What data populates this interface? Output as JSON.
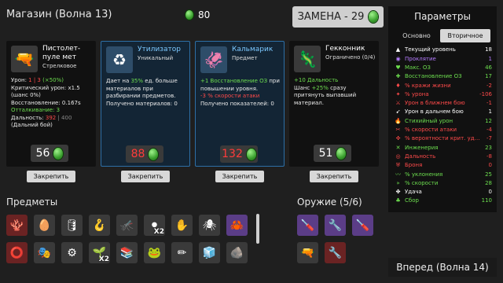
{
  "header": {
    "title": "Магазин (Волна 13)",
    "materials": "80",
    "reroll_label": "ЗАМЕНА - 29"
  },
  "shop": [
    {
      "name": "Пистолет-пуле мет",
      "subtitle": "Стрелковое",
      "icon": "gun-icon",
      "desc": [
        {
          "t": "Урон: ",
          "c": ""
        },
        {
          "t": "1 | 3",
          "c": "red"
        },
        {
          "t": " (×50%)",
          "c": "green"
        },
        {
          "t": "\nКритический урон: x1.5 (шанс 0%)",
          "c": ""
        },
        {
          "t": "\nВосстановление: 0.167s",
          "c": ""
        },
        {
          "t": "\nОтталкивание: 3",
          "c": "green"
        },
        {
          "t": "\nДальность: ",
          "c": ""
        },
        {
          "t": "392",
          "c": "red"
        },
        {
          "t": " | 400",
          "c": "dim"
        },
        {
          "t": " (Дальний бой)",
          "c": ""
        }
      ],
      "price": "56",
      "price_red": false,
      "highlight": false
    },
    {
      "name": "Утилизатор",
      "subtitle": "Уникальный",
      "icon": "recycler-icon",
      "desc": [
        {
          "t": "Дает на ",
          "c": ""
        },
        {
          "t": "35%",
          "c": "green"
        },
        {
          "t": " ед. больше материалов при разбирании предметов.",
          "c": ""
        },
        {
          "t": "\nПолучено материалов: 0",
          "c": ""
        }
      ],
      "price": "88",
      "price_red": true,
      "highlight": true
    },
    {
      "name": "Кальмарик",
      "subtitle": "Предмет",
      "icon": "squid-icon",
      "desc": [
        {
          "t": "+1 Восстановление ОЗ",
          "c": "green"
        },
        {
          "t": " при повышении уровня.",
          "c": ""
        },
        {
          "t": "\n-3 % скорости атаки",
          "c": "red"
        },
        {
          "t": "\nПолучено показателей: 0",
          "c": ""
        }
      ],
      "price": "132",
      "price_red": true,
      "highlight": true
    },
    {
      "name": "Гекконник",
      "subtitle": "Ограничено (0/4)",
      "icon": "gecko-icon",
      "desc": [
        {
          "t": "+10 Дальность",
          "c": "green"
        },
        {
          "t": "\nШанс ",
          "c": ""
        },
        {
          "t": "+25%",
          "c": "green"
        },
        {
          "t": " сразу притянуть выпавший материал.",
          "c": ""
        }
      ],
      "price": "51",
      "price_red": false,
      "highlight": false
    }
  ],
  "lock_label": "Закрепить",
  "items_title": "Предметы",
  "weapons_title": "Оружие (5/6)",
  "items": [
    {
      "icon": "coral-icon",
      "glyph": "🪸",
      "style": "red",
      "count": ""
    },
    {
      "icon": "egg-face-icon",
      "glyph": "🥚",
      "style": "",
      "count": ""
    },
    {
      "icon": "barrel-icon",
      "glyph": "🛢",
      "style": "",
      "count": ""
    },
    {
      "icon": "hook-icon",
      "glyph": "🪝",
      "style": "",
      "count": ""
    },
    {
      "icon": "mosquito-icon",
      "glyph": "🦟",
      "style": "",
      "count": ""
    },
    {
      "icon": "beads-icon",
      "glyph": "⚫",
      "style": "",
      "count": "X2"
    },
    {
      "icon": "hand-icon",
      "glyph": "✋",
      "style": "",
      "count": ""
    },
    {
      "icon": "spider-icon",
      "glyph": "🕷",
      "style": "",
      "count": ""
    },
    {
      "icon": "claw-icon",
      "glyph": "🦀",
      "style": "purple",
      "count": ""
    },
    {
      "icon": "life-ring-icon",
      "glyph": "⭕",
      "style": "red",
      "count": ""
    },
    {
      "icon": "mask-icon",
      "glyph": "🎭",
      "style": "",
      "count": ""
    },
    {
      "icon": "gear-icon",
      "glyph": "⚙",
      "style": "",
      "count": ""
    },
    {
      "icon": "sprout-icon",
      "glyph": "🌱",
      "style": "",
      "count": "X2"
    },
    {
      "icon": "books-icon",
      "glyph": "📚",
      "style": "",
      "count": ""
    },
    {
      "icon": "frog-icon",
      "glyph": "🐸",
      "style": "",
      "count": ""
    },
    {
      "icon": "pencil-icon",
      "glyph": "✏",
      "style": "",
      "count": ""
    },
    {
      "icon": "ice-cube-icon",
      "glyph": "🧊",
      "style": "",
      "count": ""
    },
    {
      "icon": "rock-icon",
      "glyph": "🪨",
      "style": "",
      "count": ""
    }
  ],
  "weapons": [
    {
      "icon": "screwdriver-icon",
      "glyph": "🪛",
      "style": "purple"
    },
    {
      "icon": "shredder-icon",
      "glyph": "🔧",
      "style": "purple"
    },
    {
      "icon": "screwdriver-icon",
      "glyph": "🪛",
      "style": "purple"
    },
    {
      "icon": "turret-icon",
      "glyph": "🔫",
      "style": ""
    },
    {
      "icon": "wrench-icon",
      "glyph": "🔧",
      "style": "red"
    }
  ],
  "stats_panel": {
    "title": "Параметры",
    "tab_primary": "Основно",
    "tab_secondary": "Вторичное",
    "rows": [
      {
        "icon": "level-icon",
        "glyph": "▲",
        "name": "Текущий уровень",
        "value": "18",
        "color": "#ffffff"
      },
      {
        "icon": "curse-icon",
        "glyph": "◉",
        "name": "Проклятие",
        "value": "1",
        "color": "#b57cff"
      },
      {
        "icon": "heart-icon",
        "glyph": "♥",
        "name": "Макс. ОЗ",
        "value": "46",
        "color": "#6ddf4f"
      },
      {
        "icon": "regen-icon",
        "glyph": "✚",
        "name": "Восстановление ОЗ",
        "value": "17",
        "color": "#6ddf4f"
      },
      {
        "icon": "lifesteal-icon",
        "glyph": "♦",
        "name": "% кражи жизни",
        "value": "-2",
        "color": "#ff4a4a"
      },
      {
        "icon": "damage-icon",
        "glyph": "✦",
        "name": "% урона",
        "value": "-106",
        "color": "#ff4a4a"
      },
      {
        "icon": "melee-icon",
        "glyph": "⚔",
        "name": "Урон в ближнем бою",
        "value": "-1",
        "color": "#ff4a4a"
      },
      {
        "icon": "ranged-icon",
        "glyph": "➹",
        "name": "Урон в дальнем бою",
        "value": "1",
        "color": "#ffffff"
      },
      {
        "icon": "elemental-icon",
        "glyph": "🔥",
        "name": "Стихийный урон",
        "value": "12",
        "color": "#6ddf4f"
      },
      {
        "icon": "attack-speed-icon",
        "glyph": "✂",
        "name": "% скорости атаки",
        "value": "-4",
        "color": "#ff4a4a"
      },
      {
        "icon": "crit-icon",
        "glyph": "✜",
        "name": "% вероятности крит. уд…",
        "value": "-7",
        "color": "#ff4a4a"
      },
      {
        "icon": "engineering-icon",
        "glyph": "✕",
        "name": "Инженерия",
        "value": "23",
        "color": "#6ddf4f"
      },
      {
        "icon": "range-icon",
        "glyph": "◎",
        "name": "Дальность",
        "value": "-8",
        "color": "#ff4a4a"
      },
      {
        "icon": "armor-icon",
        "glyph": "⛨",
        "name": "Броня",
        "value": "0",
        "color": "#ff4a4a"
      },
      {
        "icon": "dodge-icon",
        "glyph": "〰",
        "name": "% уклонения",
        "value": "25",
        "color": "#6ddf4f"
      },
      {
        "icon": "speed-icon",
        "glyph": "»",
        "name": "% скорости",
        "value": "28",
        "color": "#6ddf4f"
      },
      {
        "icon": "luck-icon",
        "glyph": "✤",
        "name": "Удача",
        "value": "0",
        "color": "#ffffff"
      },
      {
        "icon": "harvesting-icon",
        "glyph": "♣",
        "name": "Сбор",
        "value": "110",
        "color": "#6ddf4f"
      }
    ]
  },
  "next_wave_label": "Вперед (Волна 14)"
}
